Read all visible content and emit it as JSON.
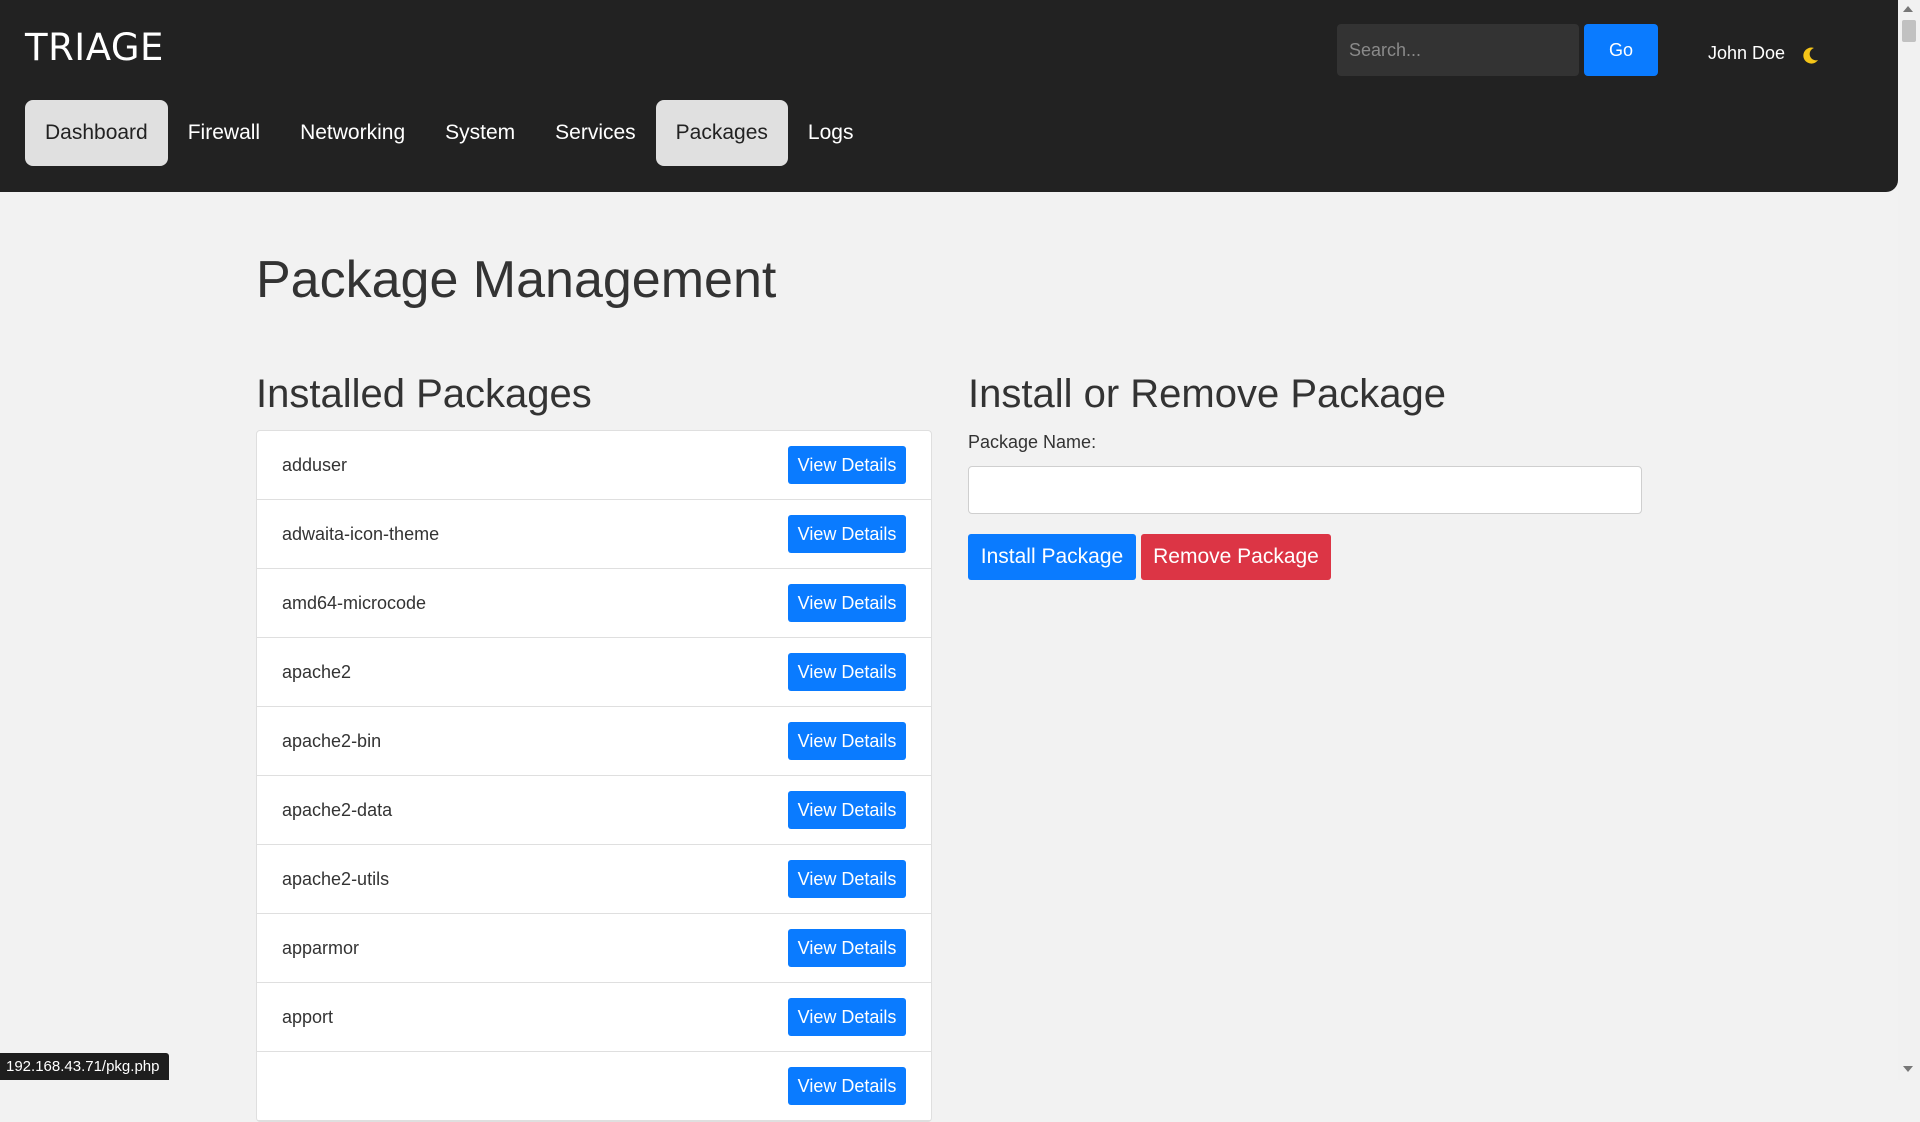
{
  "header": {
    "brand": "TRIAGE",
    "search_placeholder": "Search...",
    "go_label": "Go",
    "user_name": "John Doe",
    "theme_icon": "moon-icon"
  },
  "nav": {
    "items": [
      {
        "label": "Dashboard"
      },
      {
        "label": "Firewall"
      },
      {
        "label": "Networking"
      },
      {
        "label": "System"
      },
      {
        "label": "Services"
      },
      {
        "label": "Packages"
      },
      {
        "label": "Logs"
      }
    ],
    "highlighted": [
      "Dashboard",
      "Packages"
    ]
  },
  "main": {
    "title": "Package Management",
    "installed": {
      "title": "Installed Packages",
      "button_label": "View Details",
      "packages": [
        "adduser",
        "adwaita-icon-theme",
        "amd64-microcode",
        "apache2",
        "apache2-bin",
        "apache2-data",
        "apache2-utils",
        "apparmor",
        "apport",
        ""
      ]
    },
    "install_form": {
      "title": "Install or Remove Package",
      "field_label": "Package Name:",
      "field_value": "",
      "install_label": "Install Package",
      "remove_label": "Remove Package"
    }
  },
  "status_bar": {
    "url": "192.168.43.71/pkg.php"
  },
  "colors": {
    "header_bg": "#222222",
    "primary": "#0a7bff",
    "danger": "#dc3545",
    "page_bg": "#f2f2f2"
  }
}
